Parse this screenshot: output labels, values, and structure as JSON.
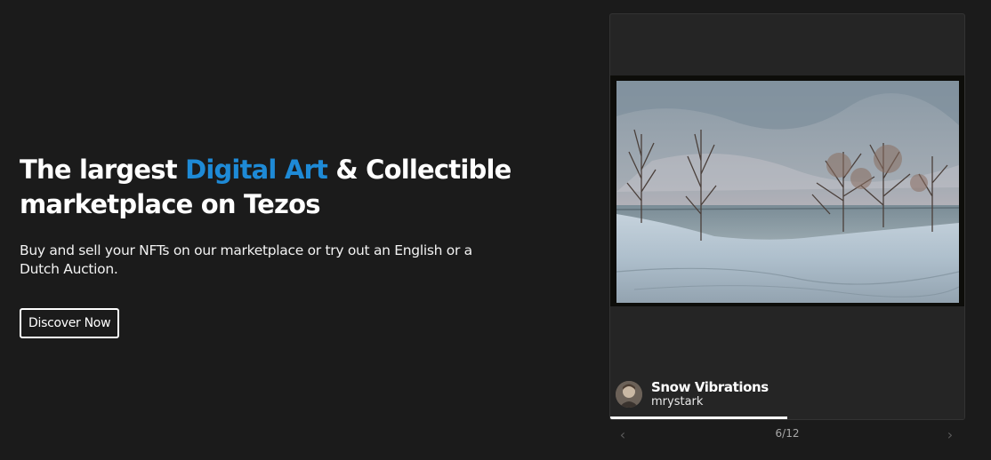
{
  "hero": {
    "title_before": "The largest ",
    "title_accent": "Digital Art",
    "title_after": " & Collectible marketplace on Tezos",
    "subtitle": "Buy and sell your NFTs on our marketplace or try out an English or a Dutch Auction.",
    "cta_label": "Discover Now"
  },
  "featured": {
    "title": "Snow Vibrations",
    "artist": "mrystark",
    "current": 6,
    "total": 12,
    "counter_text": "6/12",
    "progress_fraction": 0.5,
    "prev_icon": "chevron-left-icon",
    "next_icon": "chevron-right-icon"
  },
  "colors": {
    "background": "#1b1b1b",
    "accent": "#1e8ad6",
    "card": "#252525"
  }
}
